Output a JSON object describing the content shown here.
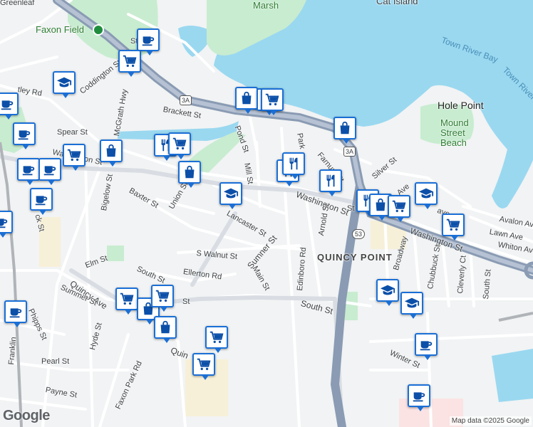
{
  "map": {
    "streets": [
      {
        "id": "greenleaf",
        "text": "Greenleaf"
      },
      {
        "id": "faxon-field",
        "text": "Faxon Field"
      },
      {
        "id": "marsh",
        "text": "Marsh"
      },
      {
        "id": "cat-island",
        "text": "Cat Island"
      },
      {
        "id": "town-river-bay",
        "text": "Town River Bay"
      },
      {
        "id": "town-river",
        "text": "Town River"
      },
      {
        "id": "hole-point",
        "text": "Hole Point"
      },
      {
        "id": "mound-street-beach",
        "text": "Mound Street Beach"
      },
      {
        "id": "coddington-st",
        "text": "Coddington St"
      },
      {
        "id": "mcgrath-hwy",
        "text": "McGrath Hwy"
      },
      {
        "id": "brackett-st",
        "text": "Brackett St"
      },
      {
        "id": "pond-st",
        "text": "Pond St"
      },
      {
        "id": "park",
        "text": "Park"
      },
      {
        "id": "farnum-st",
        "text": "Farnum St"
      },
      {
        "id": "mill-st",
        "text": "Mill St"
      },
      {
        "id": "spear-st",
        "text": "Spear St"
      },
      {
        "id": "washington-st-w",
        "text": "Washington St"
      },
      {
        "id": "bigelow-st",
        "text": "Bigelow St"
      },
      {
        "id": "baxter-st",
        "text": "Baxter St"
      },
      {
        "id": "union-st",
        "text": "Union St"
      },
      {
        "id": "lancaster-st",
        "text": "Lancaster St"
      },
      {
        "id": "washington-st-mid",
        "text": "Washington St"
      },
      {
        "id": "washington-st-e",
        "text": "Washington St"
      },
      {
        "id": "silver-st",
        "text": "Silver St"
      },
      {
        "id": "arnold-st",
        "text": "Arnold St"
      },
      {
        "id": "edinboro-rd",
        "text": "Edinboro Rd"
      },
      {
        "id": "broadway",
        "text": "Broadway"
      },
      {
        "id": "chubbuck-st",
        "text": "Chubbuck St"
      },
      {
        "id": "cleverly-ct",
        "text": "Cleverly Ct"
      },
      {
        "id": "south-st-e",
        "text": "South St"
      },
      {
        "id": "avalon-ave",
        "text": "Avalon Ave"
      },
      {
        "id": "lawn-ave",
        "text": "Lawn Ave"
      },
      {
        "id": "whiton-ave",
        "text": "Whiton Ave"
      },
      {
        "id": "quincy-point",
        "text": "QUINCY POINT"
      },
      {
        "id": "sumner-st",
        "text": "Sumner St"
      },
      {
        "id": "main-st",
        "text": "Main St"
      },
      {
        "id": "s-walnut-st",
        "text": "S Walnut St"
      },
      {
        "id": "ellerton-rd",
        "text": "Ellerton Rd"
      },
      {
        "id": "elm-st",
        "text": "Elm St"
      },
      {
        "id": "quincy-ave",
        "text": "Quincy Ave"
      },
      {
        "id": "summer-st",
        "text": "Summer St"
      },
      {
        "id": "south-st-w",
        "text": "South St"
      },
      {
        "id": "south-st-mid",
        "text": "South St"
      },
      {
        "id": "phipps-st",
        "text": "Phipps St"
      },
      {
        "id": "franklin",
        "text": "Franklin"
      },
      {
        "id": "hyde-st",
        "text": "Hyde St"
      },
      {
        "id": "pearl-st",
        "text": "Pearl St"
      },
      {
        "id": "payne-st",
        "text": "Payne St"
      },
      {
        "id": "faxon-park-rd",
        "text": "Faxon Park Rd"
      },
      {
        "id": "quin",
        "text": "Quin"
      },
      {
        "id": "winter-st",
        "text": "Winter St"
      },
      {
        "id": "ave-frag",
        "text": "Ave"
      },
      {
        "id": "ave-frag2",
        "text": "ave"
      },
      {
        "id": "tley-rd",
        "text": "tley Rd"
      },
      {
        "id": "cy",
        "text": "cy"
      },
      {
        "id": "ck-st",
        "text": "ck St"
      },
      {
        "id": "st-frag",
        "text": "St"
      },
      {
        "id": "st-frag2",
        "text": "St"
      },
      {
        "id": "st-frag3",
        "text": "St"
      }
    ],
    "shields": [
      {
        "id": "3a-west",
        "text": "3A"
      },
      {
        "id": "3a-east",
        "text": "3A"
      },
      {
        "id": "53",
        "text": "53"
      }
    ],
    "pins": [
      {
        "id": "p1",
        "icon": "coffee-icon"
      },
      {
        "id": "p2",
        "icon": "shopping-cart-icon"
      },
      {
        "id": "p3",
        "icon": "school-icon"
      },
      {
        "id": "p4",
        "icon": "coffee-icon"
      },
      {
        "id": "p5",
        "icon": "coffee-icon"
      },
      {
        "id": "p6",
        "icon": "shopping-cart-icon"
      },
      {
        "id": "p7",
        "icon": "shopping-bag-icon"
      },
      {
        "id": "p8",
        "icon": "coffee-icon"
      },
      {
        "id": "p9",
        "icon": "coffee-icon"
      },
      {
        "id": "p10",
        "icon": "coffee-icon"
      },
      {
        "id": "p11",
        "icon": "coffee-icon"
      },
      {
        "id": "p12",
        "icon": "restaurant-icon"
      },
      {
        "id": "p13",
        "icon": "shopping-cart-icon"
      },
      {
        "id": "p14",
        "icon": "shopping-bag-icon"
      },
      {
        "id": "p15",
        "icon": "shopping-bag-icon"
      },
      {
        "id": "p16",
        "icon": "shopping-cart-icon"
      },
      {
        "id": "p17",
        "icon": "school-icon"
      },
      {
        "id": "p18",
        "icon": "shopping-bag-icon"
      },
      {
        "id": "p19",
        "icon": "restaurant-icon"
      },
      {
        "id": "p20",
        "icon": "restaurant-icon"
      },
      {
        "id": "p21",
        "icon": "restaurant-icon"
      },
      {
        "id": "p22",
        "icon": "restaurant-icon"
      },
      {
        "id": "p23",
        "icon": "shopping-bag-icon"
      },
      {
        "id": "p24",
        "icon": "shopping-cart-icon"
      },
      {
        "id": "p25",
        "icon": "school-icon"
      },
      {
        "id": "p26",
        "icon": "shopping-cart-icon"
      },
      {
        "id": "p27",
        "icon": "shopping-cart-icon"
      },
      {
        "id": "p28",
        "icon": "shopping-bag-icon"
      },
      {
        "id": "p29",
        "icon": "shopping-cart-icon"
      },
      {
        "id": "p30",
        "icon": "shopping-bag-icon"
      },
      {
        "id": "p31",
        "icon": "shopping-cart-icon"
      },
      {
        "id": "p32",
        "icon": "shopping-cart-icon"
      },
      {
        "id": "p33",
        "icon": "school-icon"
      },
      {
        "id": "p34",
        "icon": "school-icon"
      },
      {
        "id": "p35",
        "icon": "coffee-icon"
      },
      {
        "id": "p36",
        "icon": "coffee-icon"
      },
      {
        "id": "p37",
        "icon": "coffee-icon"
      },
      {
        "id": "p38",
        "icon": "shopping-cart-icon"
      }
    ],
    "colors": {
      "water": "#9ad8f0",
      "park": "#c8ecd0",
      "road_major": "#8a9bb3",
      "pin_border": "#1a6fd6"
    },
    "logo": "Google",
    "attribution": "Map data ©2025 Google"
  }
}
